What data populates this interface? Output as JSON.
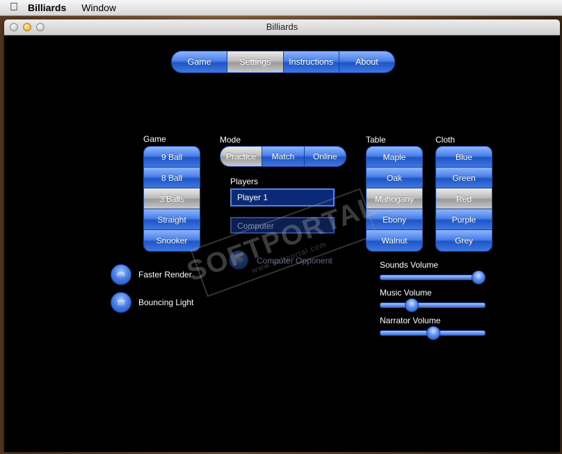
{
  "menubar": {
    "apple": "",
    "app_name": "Billiards",
    "items": [
      "Window"
    ]
  },
  "window": {
    "title": "Billiards"
  },
  "nav": {
    "tabs": [
      {
        "label": "Game",
        "selected": false
      },
      {
        "label": "Settings",
        "selected": true
      },
      {
        "label": "Instructions",
        "selected": false
      },
      {
        "label": "About",
        "selected": false
      }
    ]
  },
  "game": {
    "title": "Game",
    "options": [
      {
        "label": "9 Ball",
        "selected": false
      },
      {
        "label": "8 Ball",
        "selected": false
      },
      {
        "label": "3 Balls",
        "selected": true
      },
      {
        "label": "Straight",
        "selected": false
      },
      {
        "label": "Snooker",
        "selected": false
      }
    ]
  },
  "mode": {
    "title": "Mode",
    "options": [
      {
        "label": "Practice",
        "selected": true
      },
      {
        "label": "Match",
        "selected": false
      },
      {
        "label": "Online",
        "selected": false
      }
    ]
  },
  "players": {
    "title": "Players",
    "player1": "Player 1",
    "player2": "Computer",
    "computer_opponent_label": "Computer Opponent"
  },
  "table": {
    "title": "Table",
    "options": [
      {
        "label": "Maple",
        "selected": false
      },
      {
        "label": "Oak",
        "selected": false
      },
      {
        "label": "Mahogany",
        "selected": true
      },
      {
        "label": "Ebony",
        "selected": false
      },
      {
        "label": "Walnut",
        "selected": false
      }
    ]
  },
  "cloth": {
    "title": "Cloth",
    "options": [
      {
        "label": "Blue",
        "selected": false
      },
      {
        "label": "Green",
        "selected": false
      },
      {
        "label": "Red",
        "selected": true
      },
      {
        "label": "Purple",
        "selected": false
      },
      {
        "label": "Grey",
        "selected": false
      }
    ]
  },
  "options": {
    "faster_render": "Faster Render",
    "bouncing_light": "Bouncing Light"
  },
  "volumes": {
    "sounds": {
      "label": "Sounds Volume",
      "value": 0.93
    },
    "music": {
      "label": "Music Volume",
      "value": 0.29
    },
    "narrator": {
      "label": "Narrator Volume",
      "value": 0.5
    }
  },
  "watermark": {
    "text": "SOFTPORTAL",
    "url": "www.softportal.com"
  },
  "colors": {
    "accent": "#4a80e8",
    "selected": "#bdbdbd",
    "background": "#000000"
  }
}
